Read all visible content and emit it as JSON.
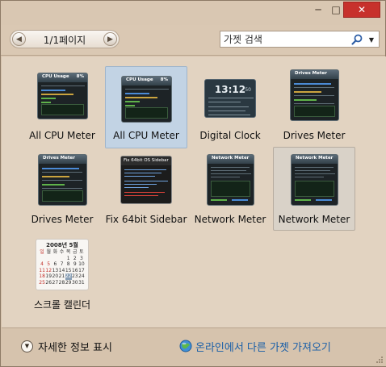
{
  "window": {
    "buttons": {
      "minimize": "─",
      "maximize": "□",
      "close": "✕"
    }
  },
  "toolbar": {
    "pager": {
      "prev_icon": "chevron-left-icon",
      "next_icon": "chevron-right-icon",
      "label": "1/1페이지"
    },
    "search": {
      "placeholder": "가젯 검색",
      "icon": "search-icon",
      "dropdown_icon": "chevron-down-icon"
    }
  },
  "gadgets": [
    {
      "label": "All CPU Meter",
      "thumb_title": "CPU Usage",
      "thumb_value": "8%",
      "state": "normal"
    },
    {
      "label": "All CPU Meter",
      "thumb_title": "CPU Usage",
      "thumb_value": "8%",
      "state": "selected"
    },
    {
      "label": "Digital Clock",
      "thumb_title": "13:12",
      "thumb_value": "50",
      "state": "normal"
    },
    {
      "label": "Drives Meter",
      "thumb_title": "Drives Meter",
      "thumb_value": "",
      "state": "normal"
    },
    {
      "label": "Drives Meter",
      "thumb_title": "Drives Meter",
      "thumb_value": "",
      "state": "normal"
    },
    {
      "label": "Fix 64bit Sidebar",
      "thumb_title": "Fix 64bit OS Sidebar",
      "thumb_value": "",
      "state": "normal"
    },
    {
      "label": "Network Meter",
      "thumb_title": "Network Meter",
      "thumb_value": "",
      "state": "normal"
    },
    {
      "label": "Network Meter",
      "thumb_title": "Network Meter",
      "thumb_value": "",
      "state": "hover"
    },
    {
      "label": "스크롤 캘린더",
      "thumb_title": "2008년 5월",
      "thumb_value": "",
      "state": "normal"
    }
  ],
  "footer": {
    "details_label": "자세한 정보 표시",
    "details_icon": "chevron-down-circle-icon",
    "online_label": "온라인에서 다른 가젯 가져오기",
    "online_icon": "globe-icon"
  },
  "colors": {
    "accent_link": "#1a5fa8",
    "selection_blue": "#c2d3e4",
    "close_red": "#c7312c"
  }
}
